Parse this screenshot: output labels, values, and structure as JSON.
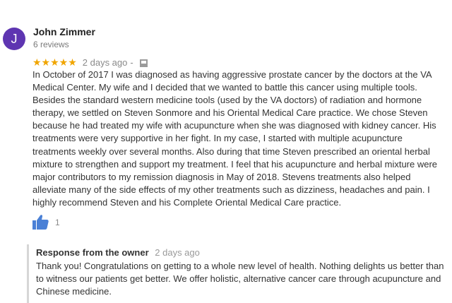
{
  "reviewer": {
    "initial": "J",
    "name": "John Zimmer",
    "review_count": "6 reviews",
    "avatar_color": "#5e35b1"
  },
  "review": {
    "rating": 5,
    "stars": "★★★★★",
    "date": "2 days ago",
    "separator": "-",
    "text": "In October of 2017 I was diagnosed as having aggressive prostate cancer by the doctors at the VA Medical Center. My wife and I decided that we wanted to battle this cancer using multiple tools. Besides the standard western medicine tools (used by the VA doctors) of radiation and hormone therapy, we settled on Steven Sonmore and his Oriental Medical Care practice. We chose Steven because he had treated my wife with acupuncture when she was diagnosed with kidney cancer. His treatments were very supportive in her fight. In my case, I started with multiple acupuncture treatments weekly over several months. Also during that time Steven prescribed an oriental herbal mixture to strengthen and support my treatment. I feel that his acupuncture and herbal mixture were major contributors to my remission diagnosis in May of 2018. Stevens treatments also helped alleviate many of the side effects of my other treatments such as dizziness, headaches and pain. I highly recommend Steven and his Complete Oriental Medical Care practice.",
    "like_count": "1",
    "star_color": "#f0a500",
    "like_icon_color": "#4a80d6"
  },
  "owner_response": {
    "title": "Response from the owner",
    "date": "2 days ago",
    "text": "Thank you! Congratulations on getting to a whole new level of health. Nothing delights us better than to witness our patients get better. We offer holistic, alternative cancer care through acupuncture and Chinese medicine."
  }
}
